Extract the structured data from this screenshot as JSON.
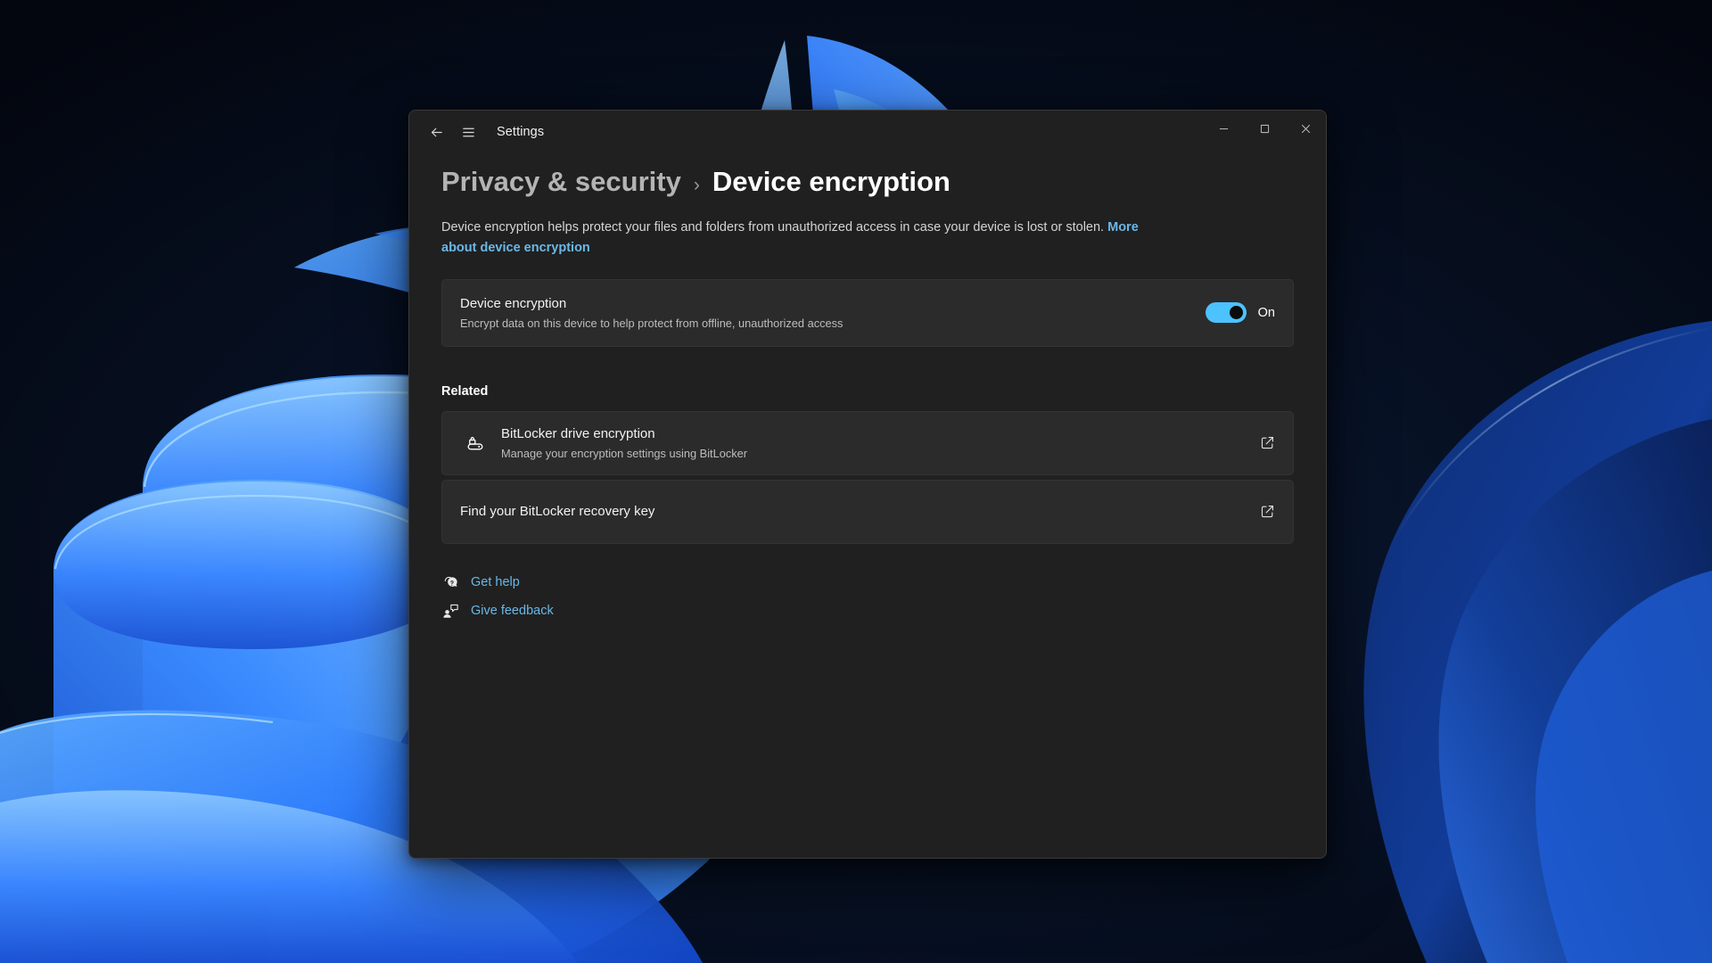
{
  "window": {
    "app_title": "Settings",
    "titlebar": {
      "back_icon": "back-arrow-icon",
      "menu_icon": "hamburger-menu-icon",
      "minimize_label": "—",
      "maximize_label": "☐",
      "close_label": "✕"
    }
  },
  "breadcrumb": {
    "parent": "Privacy & security",
    "separator": "›",
    "current": "Device encryption"
  },
  "description": {
    "text": "Device encryption helps protect your files and folders from unauthorized access in case your device is lost or stolen.",
    "link_text": "More about device encryption"
  },
  "device_encryption_setting": {
    "title": "Device encryption",
    "subtitle": "Encrypt data on this device to help protect from offline, unauthorized access",
    "toggle_state": "On",
    "toggle_on": true
  },
  "related": {
    "heading": "Related",
    "items": [
      {
        "title": "BitLocker drive encryption",
        "subtitle": "Manage your encryption settings using BitLocker",
        "lead_icon": "bitlocker-drive-icon",
        "action_icon": "open-external-icon"
      },
      {
        "title": "Find your BitLocker recovery key",
        "subtitle": "",
        "lead_icon": "",
        "action_icon": "open-external-icon"
      }
    ]
  },
  "footer": {
    "links": [
      {
        "label": "Get help",
        "icon": "help-question-bubble-icon"
      },
      {
        "label": "Give feedback",
        "icon": "feedback-person-bubble-icon"
      }
    ]
  },
  "colors": {
    "accent": "#4cc2ff",
    "link": "#6ab8e8",
    "window_bg": "#202020",
    "card_bg": "#2b2b2b",
    "desktop_dark": "#050a16",
    "wallpaper_blue": "#2d7dfb"
  }
}
